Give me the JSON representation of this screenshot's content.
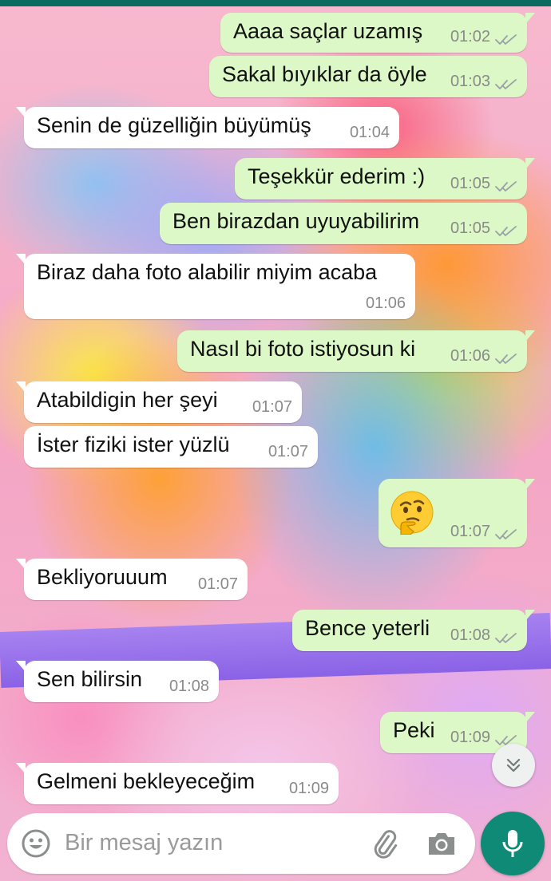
{
  "chat": {
    "messages": [
      {
        "dir": "out",
        "text": "Aaaa saçlar uzamış",
        "time": "01:02"
      },
      {
        "dir": "out",
        "text": "Sakal bıyıklar da öyle",
        "time": "01:03"
      },
      {
        "dir": "in",
        "text": "Senin de güzelliğin büyümüş",
        "time": "01:04"
      },
      {
        "dir": "out",
        "text": "Teşekkür ederim :)",
        "time": "01:05"
      },
      {
        "dir": "out",
        "text": "Ben birazdan uyuyabilirim",
        "time": "01:05"
      },
      {
        "dir": "in",
        "text": "Biraz daha foto alabilir miyim acaba",
        "time": "01:06"
      },
      {
        "dir": "out",
        "text": "Nasıl bi foto istiyosun ki",
        "time": "01:06"
      },
      {
        "dir": "in",
        "text": "Atabildigin her şeyi",
        "time": "01:07"
      },
      {
        "dir": "in",
        "text": "İster fiziki ister yüzlü",
        "time": "01:07"
      },
      {
        "dir": "out",
        "text": "",
        "emoji": "thinking-face",
        "time": "01:07"
      },
      {
        "dir": "in",
        "text": "Bekliyoruuum",
        "time": "01:07"
      },
      {
        "dir": "out",
        "text": "Bence yeterli",
        "time": "01:08"
      },
      {
        "dir": "in",
        "text": "Sen bilirsin",
        "time": "01:08"
      },
      {
        "dir": "out",
        "text": "Peki",
        "time": "01:09"
      },
      {
        "dir": "in",
        "text": "Gelmeni bekleyeceğim",
        "time": "01:09"
      }
    ]
  },
  "composer": {
    "placeholder": "Bir mesaj yazın",
    "icons": [
      "emoji-icon",
      "paperclip-icon",
      "camera-icon",
      "microphone-icon",
      "scroll-down-icon"
    ]
  },
  "colors": {
    "outgoing_bubble": "#dcf8c6",
    "incoming_bubble": "#ffffff",
    "tick": "#9aa0a6",
    "mic_button": "#0f8a76",
    "top_bar": "#0c6b5f"
  }
}
